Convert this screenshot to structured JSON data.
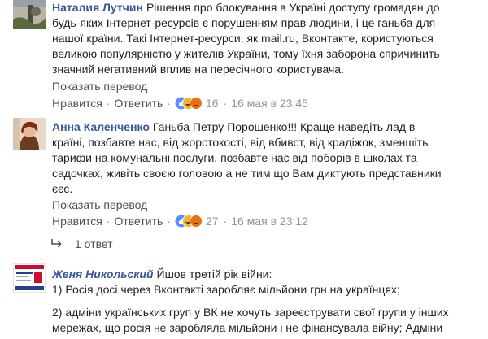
{
  "comments": [
    {
      "author": "Наталия Лутчин",
      "lines": [
        "Рішення про блокування в Україні доступу громадян до",
        "будь-яких Інтернет-ресурсів є порушенням прав людини, і це ганьба для",
        "нашої країни. Такі Інтернет-ресурси, як mail.ru, Вконтакте, користуються",
        "великою популярністю у жителів України, тому їхня заборона спричинить",
        "значний негативний вплив на пересічного користувача."
      ],
      "translate_label": "Показать перевод",
      "like_label": "Нравится",
      "reply_label": "Ответить",
      "reaction_count": "16",
      "timestamp": "16 мая в 23:45"
    },
    {
      "author": "Анна Каленченко",
      "lines": [
        "Ганьба Петру Порошенко!!! Краще наведіть лад в",
        "країні, позбавте нас, від жорстокості, від вбивст, від крадіжок, зменшіть",
        "тарифи на комунальні послуги, позбавте нас від поборів в школах та",
        "садочках, живіть своєю головою а не тим що Вам диктують представники",
        "єєс."
      ],
      "translate_label": "Показать перевод",
      "like_label": "Нравится",
      "reply_label": "Ответить",
      "reaction_count": "27",
      "timestamp": "16 мая в 23:12"
    },
    {
      "author": "Женя Никольский",
      "lines": [
        "Йшов третій рік війни:",
        "1) Росія досі через Вконтакті заробляє мільйони грн на українцях;",
        "",
        "2) адміни українських груп у ВК не хочуть зареєструвати свої групи у інших",
        "мережах, що росія не заробляла мільйони і не фінансувала війну; Адміни"
      ]
    }
  ],
  "replies": {
    "label": "1 ответ"
  },
  "icons": {
    "reply_arrow": "reply-arrow-icon",
    "like": "like-reaction-icon",
    "haha": "haha-reaction-icon",
    "angry": "angry-reaction-icon"
  },
  "colors": {
    "author": "#365899",
    "meta": "#90949c",
    "like": "#5890ff",
    "angry": "#e9710f",
    "haha": "#f7b125"
  }
}
